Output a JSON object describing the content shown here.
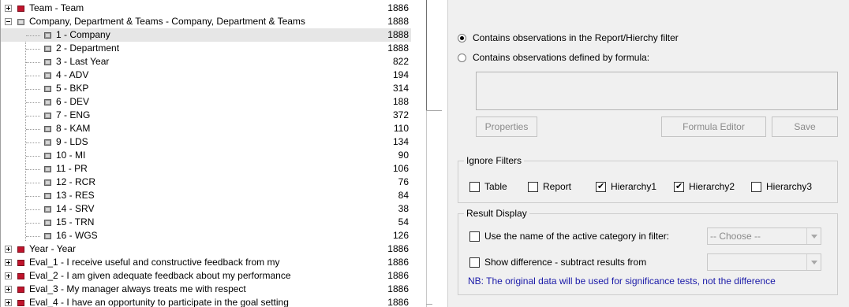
{
  "tree": {
    "rows": [
      {
        "label": "Team - Team",
        "count": "1886"
      },
      {
        "label": "Company, Department & Teams - Company, Department & Teams",
        "count": "1888"
      },
      {
        "label": "1 - Company",
        "count": "1888"
      },
      {
        "label": "2 - Department",
        "count": "1888"
      },
      {
        "label": "3 - Last Year",
        "count": "822"
      },
      {
        "label": "4 - ADV",
        "count": "194"
      },
      {
        "label": "5 - BKP",
        "count": "314"
      },
      {
        "label": "6 - DEV",
        "count": "188"
      },
      {
        "label": "7 - ENG",
        "count": "372"
      },
      {
        "label": "8 - KAM",
        "count": "110"
      },
      {
        "label": "9 - LDS",
        "count": "134"
      },
      {
        "label": "10 - MI",
        "count": "90"
      },
      {
        "label": "11 - PR",
        "count": "106"
      },
      {
        "label": "12 - RCR",
        "count": "76"
      },
      {
        "label": "13 - RES",
        "count": "84"
      },
      {
        "label": "14 - SRV",
        "count": "38"
      },
      {
        "label": "15 - TRN",
        "count": "54"
      },
      {
        "label": "16 - WGS",
        "count": "126"
      },
      {
        "label": "Year - Year",
        "count": "1886"
      },
      {
        "label": "Eval_1 - I receive useful and constructive feedback from my",
        "count": "1886"
      },
      {
        "label": "Eval_2 - I am given adequate feedback about my performance",
        "count": "1886"
      },
      {
        "label": "Eval_3 - My manager always treats me with respect",
        "count": "1886"
      },
      {
        "label": "Eval_4 - I have an opportunity to participate in the goal setting",
        "count": "1886"
      }
    ]
  },
  "filter": {
    "radio_report": "Contains observations in the Report/Hierchy filter",
    "radio_formula": "Contains observations defined by formula:",
    "buttons": {
      "properties": "Properties",
      "formula_editor": "Formula Editor",
      "save": "Save"
    }
  },
  "ignore_filters": {
    "legend": "Ignore Filters",
    "items": [
      {
        "label": "Table",
        "checked": false
      },
      {
        "label": "Report",
        "checked": false
      },
      {
        "label": "Hierarchy1",
        "checked": true
      },
      {
        "label": "Hierarchy2",
        "checked": true
      },
      {
        "label": "Hierarchy3",
        "checked": false
      }
    ]
  },
  "result_display": {
    "legend": "Result Display",
    "use_name_label": "Use the name of the active category in filter:",
    "choose_placeholder": "-- Choose --",
    "show_difference_label": "Show difference  - subtract results from",
    "note": "NB: The original data will be used for significance tests, not the difference"
  },
  "colors": {
    "selected_row": "#e6e6e6",
    "note_text": "#1a1aa8",
    "node_red": "#c0142c"
  }
}
